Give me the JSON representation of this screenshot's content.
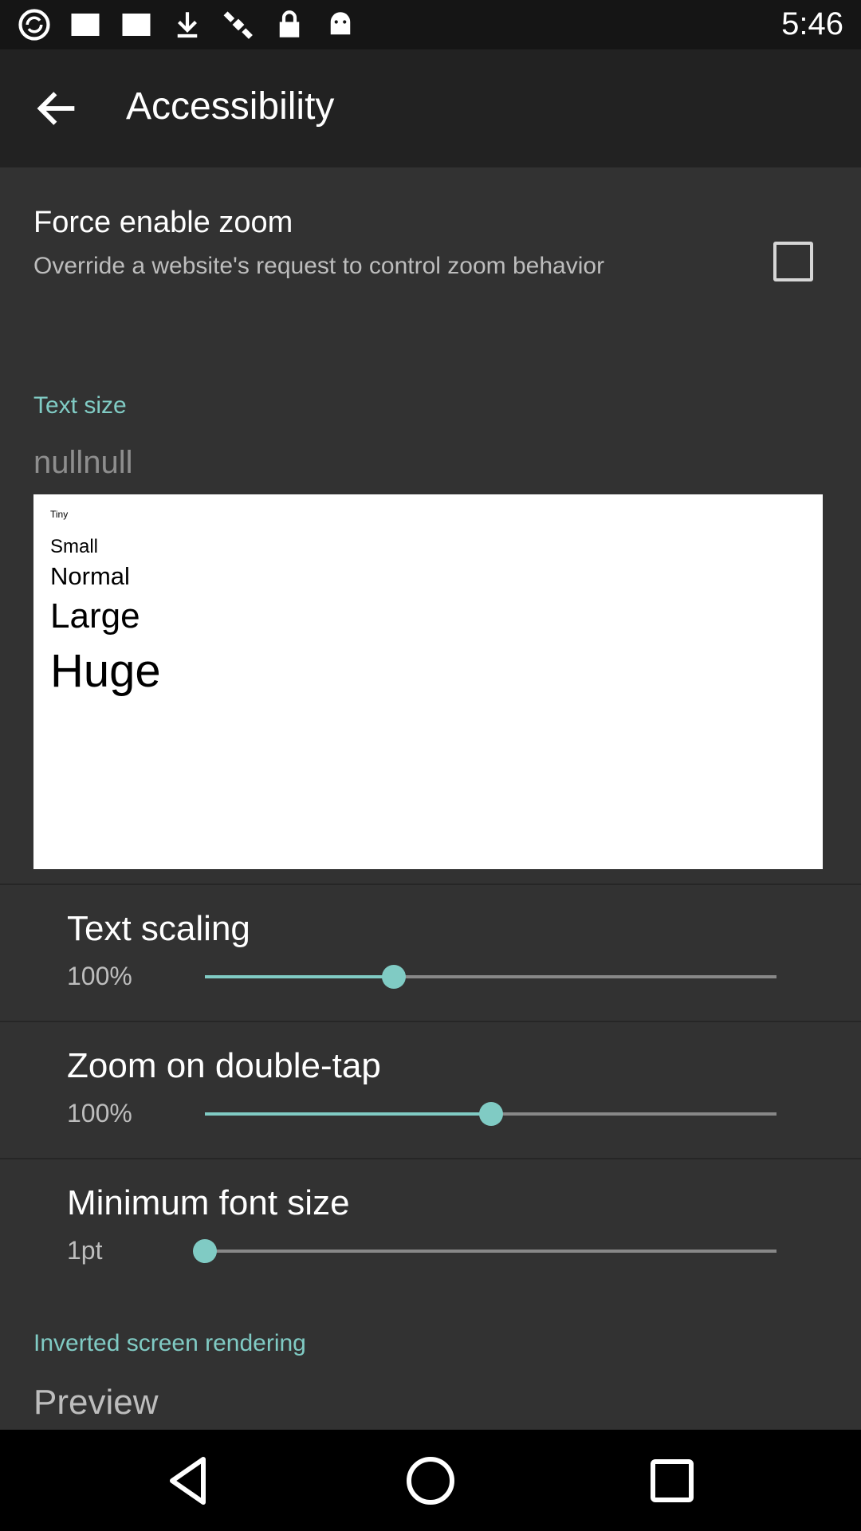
{
  "status_bar": {
    "time": "5:46",
    "icons": [
      "sync-icon",
      "white-square-icon",
      "white-square-icon",
      "download-icon",
      "satellite-icon",
      "lock-icon",
      "android-icon"
    ]
  },
  "toolbar": {
    "title": "Accessibility"
  },
  "force_zoom": {
    "title": "Force enable zoom",
    "summary": "Override a website's request to control zoom behavior",
    "checked": false
  },
  "text_size": {
    "category": "Text size",
    "value": "nullnull",
    "preview": [
      "Tiny",
      "Small",
      "Normal",
      "Large",
      "Huge"
    ]
  },
  "text_scaling": {
    "title": "Text scaling",
    "value": "100%",
    "position": 0.33
  },
  "zoom_double_tap": {
    "title": "Zoom on double-tap",
    "value": "100%",
    "position": 0.5
  },
  "min_font": {
    "title": "Minimum font size",
    "value": "1pt",
    "position": 0.0
  },
  "inverted": {
    "category": "Inverted screen rendering",
    "preview_label": "Preview"
  },
  "colors": {
    "accent": "#80cbc4",
    "background": "#323232",
    "toolbar": "#222222"
  }
}
